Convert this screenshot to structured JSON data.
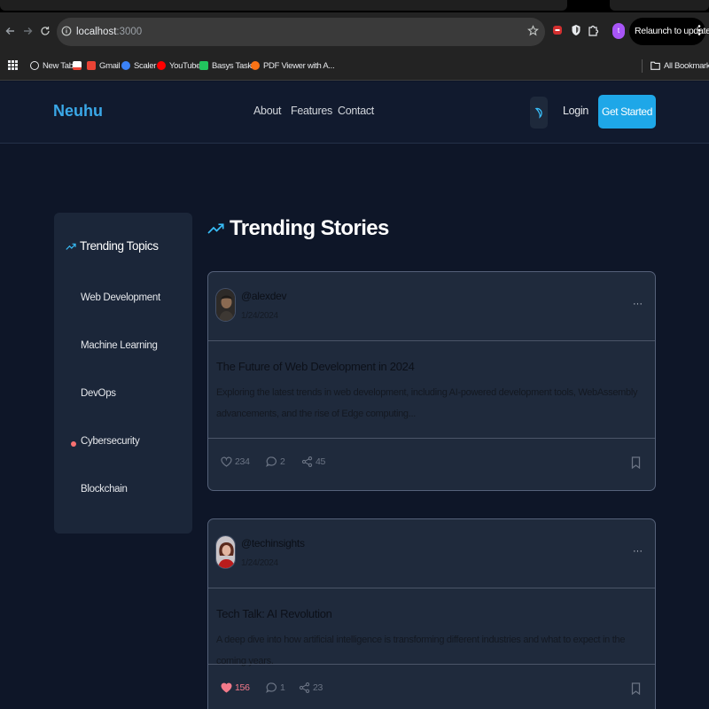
{
  "browser": {
    "url_host": "localhost",
    "url_port": ":3000",
    "relaunch_label": "Relaunch to update",
    "profile_initial": "t",
    "bookmarks": [
      {
        "label": "New Tab",
        "icon": "globe-icon",
        "color": "#e8eaed"
      },
      {
        "label": "",
        "icon": "gmail-icon",
        "color": "#ea4335"
      },
      {
        "label": "Gmail",
        "icon": "gmail-icon",
        "color": "#ea4335"
      },
      {
        "label": "Scaler",
        "icon": "scaler-icon",
        "color": "#3b82f6"
      },
      {
        "label": "YouTube",
        "icon": "youtube-icon",
        "color": "#ff0000"
      },
      {
        "label": "Basys Tasks",
        "icon": "basys-icon",
        "color": "#22c55e"
      },
      {
        "label": "PDF Viewer with A...",
        "icon": "pdf-icon",
        "color": "#f97316"
      }
    ],
    "all_bookmarks": "All Bookmarks"
  },
  "site": {
    "logo": "Neuhu",
    "nav": [
      "About",
      "Features",
      "Contact"
    ],
    "login": "Login",
    "cta": "Get Started"
  },
  "sidebar": {
    "title": "Trending Topics",
    "items": [
      {
        "label": "Web Development",
        "active": false
      },
      {
        "label": "Machine Learning",
        "active": false
      },
      {
        "label": "DevOps",
        "active": false
      },
      {
        "label": "Cybersecurity",
        "active": true
      },
      {
        "label": "Blockchain",
        "active": false
      }
    ]
  },
  "feed": {
    "title": "Trending Stories",
    "posts": [
      {
        "handle": "@alexdev",
        "date": "1/24/2024",
        "more": "···",
        "title": "The Future of Web Development in 2024",
        "excerpt": "Exploring the latest trends in web development, including AI-powered development tools, WebAssembly advancements, and the rise of Edge computing...",
        "likes": "234",
        "comments": "2",
        "shares": "45",
        "liked": false
      },
      {
        "handle": "@techinsights",
        "date": "1/24/2024",
        "more": "···",
        "title": "Tech Talk: AI Revolution",
        "excerpt": "A deep dive into how artificial intelligence is transforming different industries and what to expect in the coming years.",
        "likes": "156",
        "comments": "1",
        "shares": "23",
        "liked": true
      }
    ]
  },
  "colors": {
    "accent": "#1ea7e8",
    "background": "#0e1628",
    "card": "#1f2a3c",
    "like": "#f37a8a",
    "active_dot": "#f87171"
  }
}
